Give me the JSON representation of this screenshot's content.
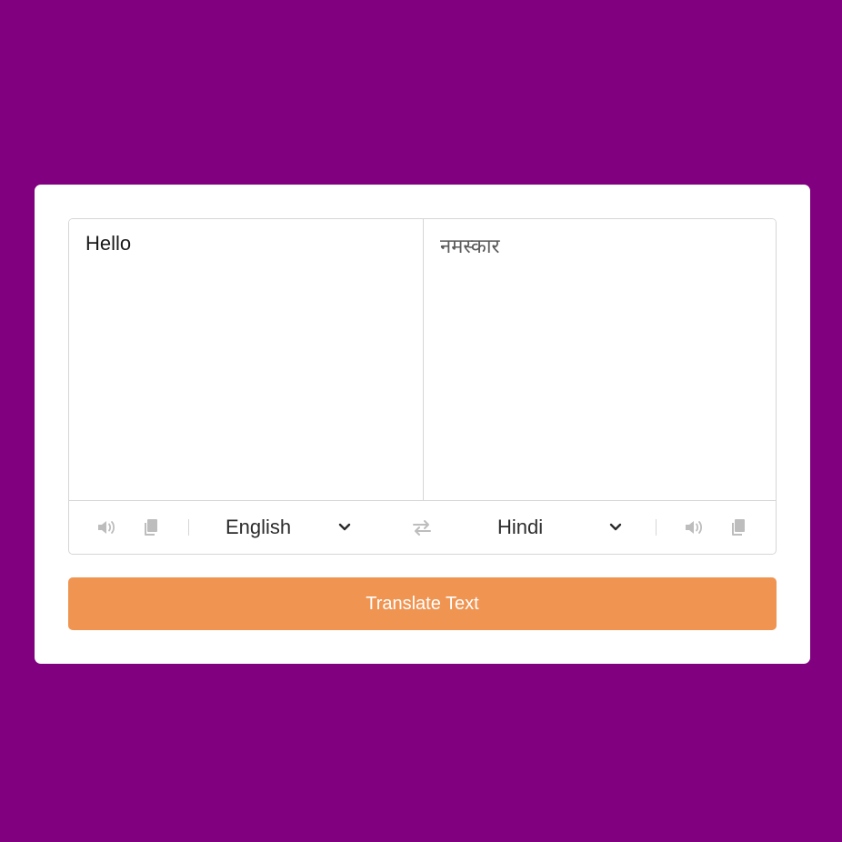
{
  "from": {
    "text": "Hello",
    "language": "English"
  },
  "to": {
    "text": "नमस्कार",
    "language": "Hindi"
  },
  "actions": {
    "translate_label": "Translate Text"
  },
  "icons": {
    "speaker": "volume-icon",
    "copy": "copy-icon",
    "swap": "exchange-icon",
    "chevron": "chevron-down-icon"
  },
  "colors": {
    "page_background": "#800080",
    "button_background": "#f09452",
    "icon_gray": "#bdbdbd"
  }
}
